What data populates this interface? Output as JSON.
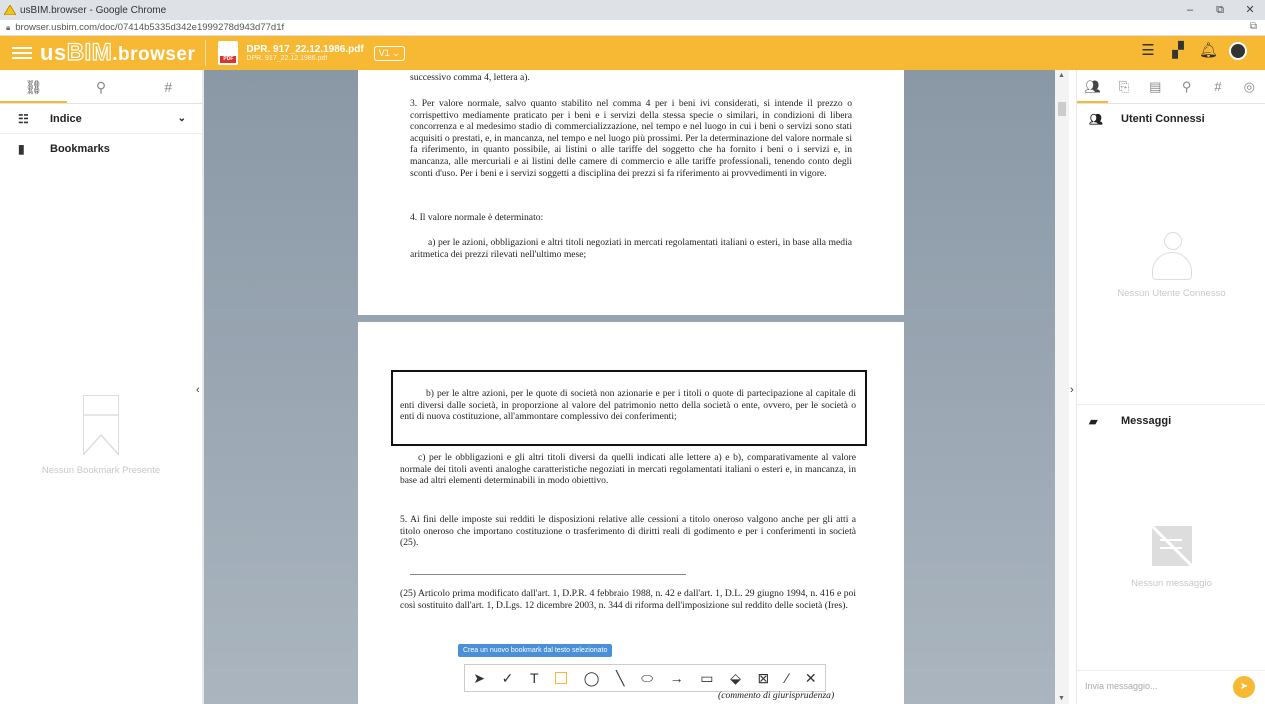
{
  "browser": {
    "tab_title": "usBIM.browser - Google Chrome",
    "url": "browser.usbim.com/doc/07414b5335d342e1999278d943d77d1f",
    "min": "–",
    "restore": "⧉",
    "close": "✕"
  },
  "app": {
    "logo_us": "us",
    "logo_bim": "BIM",
    "logo_suffix": ".browser",
    "doc_title": "DPR. 917_22.12.1986.pdf",
    "doc_subtitle": "DPR. 917_22.12.1986.pdf",
    "version": "V1 ⌄",
    "accent": "#f7b933"
  },
  "left": {
    "tab1": "⛓",
    "tab2": "⚲",
    "tab3": "#",
    "indice": "Indice",
    "bookmarks": "Bookmarks",
    "empty": "Nessun Bookmark Presente"
  },
  "doc": {
    "p1_a": "successivo comma 4, lettera a).",
    "p1_b": "3. Per valore normale, salvo quanto stabilito nel comma 4 per i beni ivi considerati, si intende il prezzo o corrispettivo mediamente praticato per i beni e i servizi della stessa specie o similari, in condizioni di libera concorrenza e al medesimo stadio di commercializzazione, nel tempo e nel luogo in cui i beni o servizi sono stati acquisiti o prestati, e, in mancanza, nel tempo e nel luogo più prossimi. Per la determinazione del valore normale si fa riferimento, in quanto possibile, ai listini o alle tariffe del soggetto che ha fornito i beni o i servizi e, in mancanza, alle mercuriali e ai listini delle camere di commercio e alle tariffe professionali, tenendo conto degli sconti d'uso. Per i beni e i servizi soggetti a disciplina dei prezzi si fa riferimento ai provvedimenti in vigore.",
    "p1_c": "4. Il valore normale è determinato:",
    "p1_d": "a) per le azioni, obbligazioni e altri titoli negoziati in mercati regolamentati italiani o esteri, in base alla media aritmetica dei prezzi rilevati nell'ultimo mese;",
    "p2_b": "b) per le altre azioni, per le quote di società non azionarie e per i titoli o quote di partecipazione al capitale di enti diversi dalle società, in proporzione al valore del patrimonio netto della società o ente, ovvero, per le società o enti di nuova costituzione, all'ammontare complessivo dei conferimenti;",
    "p2_c": "c) per le obbligazioni e gli altri titoli diversi da quelli indicati alle lettere a) e b), comparativamente al valore normale dei titoli aventi analoghe caratteristiche negoziati in mercati regolamentati italiani o esteri e, in mancanza, in base ad altri elementi determinabili in modo obiettivo.",
    "p2_5": "5. Ai fini delle imposte sui redditi le disposizioni relative alle cessioni a titolo oneroso valgono anche per gli atti a titolo oneroso che importano costituzione o trasferimento di diritti reali di godimento e per i conferimenti in società (25).",
    "p2_fn": "(25) Articolo prima modificato dall'art. 1, D.P.R. 4 febbraio 1988, n. 42 e dall'art. 1, D.L. 29 giugno 1994, n. 416 e poi così sostituito dall'art. 1, D.Lgs. 12 dicembre 2003, n. 344 di riforma dell'imposizione sul reddito delle società (Ires).",
    "commento": "(commento di giurisprudenza)"
  },
  "tooltip": "Crea un nuovo bookmark dal testo selezionato",
  "toolbar": {
    "t1": "➤",
    "t2": "✓",
    "t3": "T",
    "t5": "◯",
    "t6": "╲",
    "t7": "⬭",
    "t8": "→",
    "t9": "▭",
    "t10": "⬙",
    "t11": "⊠",
    "t12": "∕",
    "t13": "✕"
  },
  "right": {
    "utenti": "Utenti Connessi",
    "no_users": "Nessun Utente Connesso",
    "messaggi": "Messaggi",
    "no_msg": "Nessun messaggio",
    "input_placeholder": "Invia messaggio...",
    "send": "➤"
  }
}
